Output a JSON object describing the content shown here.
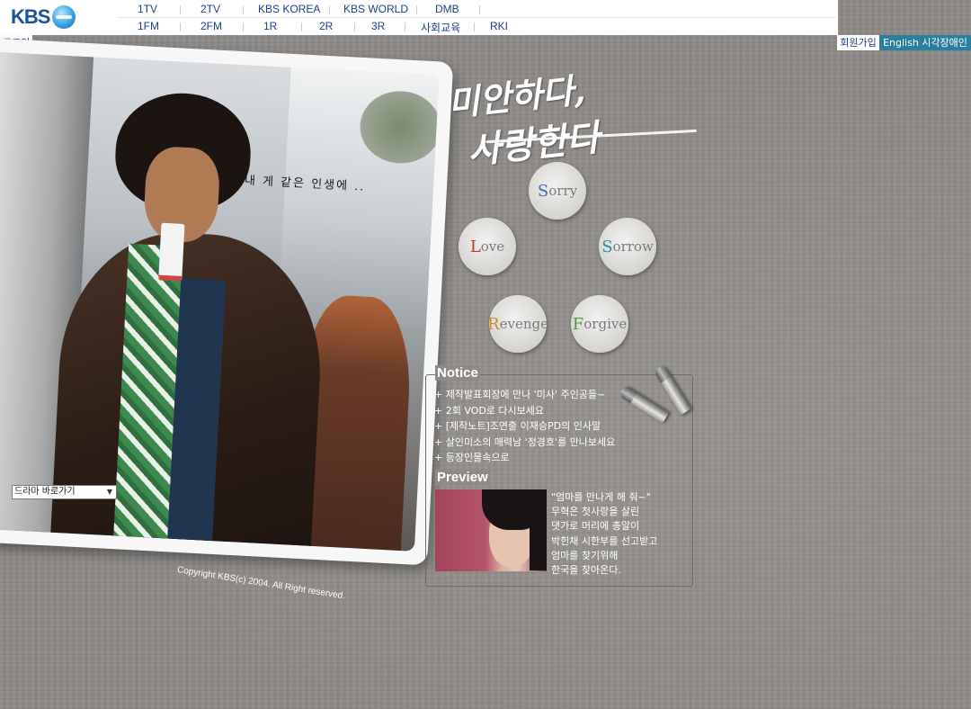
{
  "logo": {
    "text": "KBS"
  },
  "nav": {
    "row1": [
      "1TV",
      "2TV",
      "KBS KOREA",
      "KBS WORLD",
      "DMB"
    ],
    "row2": [
      "1FM",
      "2FM",
      "1R",
      "2R",
      "3R",
      "사회교육",
      "RKI"
    ]
  },
  "account": {
    "login": "로그인",
    "join": "회원가입",
    "english": "English 시각장애인"
  },
  "photo": {
    "caption": "내 게 같은 인생에 ..",
    "copyright": "Copyright KBS(c) 2004. All Right reserved."
  },
  "drama_select": {
    "selected": "드라마 바로가기"
  },
  "title": {
    "line1": "미안하다,",
    "line2": "사랑한다"
  },
  "menu": {
    "sorry": {
      "first": "S",
      "rest": "orry",
      "accent": "#3f6fb0"
    },
    "love": {
      "first": "L",
      "rest": "ove",
      "accent": "#c0392b"
    },
    "sorrow": {
      "first": "S",
      "rest": "orrow",
      "accent": "#2a8fa6"
    },
    "revenge": {
      "first": "R",
      "rest": "evenge",
      "accent": "#c98a2a"
    },
    "forgive": {
      "first": "F",
      "rest": "orgive",
      "accent": "#4e9a3a"
    }
  },
  "notice": {
    "title": "Notice",
    "items": [
      "+ 제작발표회장에 만나 '미사' 주인공들~",
      "+ 2회 VOD로 다시보세요",
      "+ [제작노트]조연출 이재승PD의 인사말",
      "+ 살인미소의 매력남 '정경호'를 만나보세요",
      "+ 등장인물속으로"
    ]
  },
  "preview": {
    "title": "Preview",
    "lines": [
      "\"엄마를 만나게 해 줘~\"",
      "무혁은 첫사랑을 살린",
      "댓가로 머리에 총알이",
      "박힌채 시한부를 선고받고",
      "엄마를 찾기위해",
      "한국을 찾아온다."
    ]
  }
}
